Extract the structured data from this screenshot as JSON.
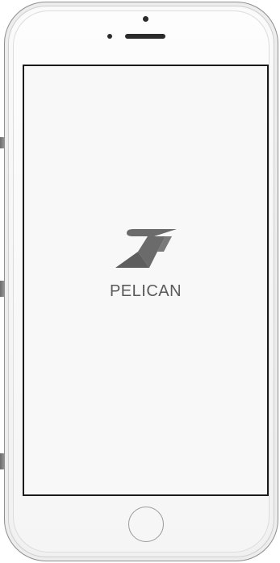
{
  "device": {
    "type": "smartphone",
    "color": "silver-white"
  },
  "screen": {
    "background_color": "#f8f8f8",
    "app_name": "PELICAN",
    "logo_icon": "pelican-logo-icon",
    "logo_color": "#6b6b6b"
  }
}
